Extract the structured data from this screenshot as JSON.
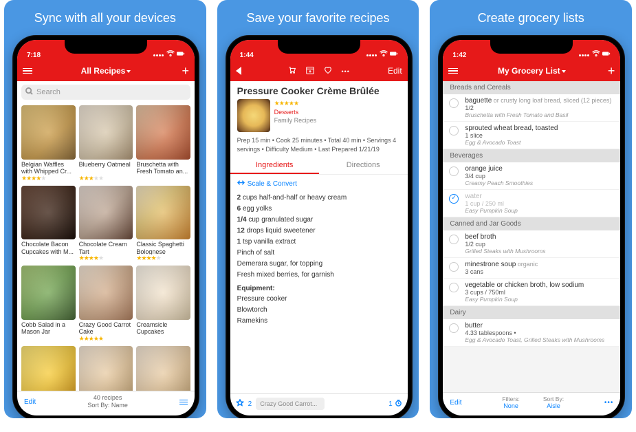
{
  "panels": {
    "p1_title": "Sync with all your devices",
    "p2_title": "Save your favorite recipes",
    "p3_title": "Create grocery lists"
  },
  "p1": {
    "time": "7:18",
    "nav_title": "All Recipes",
    "search_placeholder": "Search",
    "cards": [
      {
        "title": "Belgian Waffles with Whipped Cr...",
        "stars": 4
      },
      {
        "title": "Blueberry Oatmeal",
        "stars": 3
      },
      {
        "title": "Bruschetta with Fresh Tomato an...",
        "stars": 0
      },
      {
        "title": "Chocolate Bacon Cupcakes with M...",
        "stars": 0
      },
      {
        "title": "Chocolate Cream Tart",
        "stars": 4
      },
      {
        "title": "Classic Spaghetti Bolognese",
        "stars": 4
      },
      {
        "title": "Cobb Salad in a Mason Jar",
        "stars": 0
      },
      {
        "title": "Crazy Good Carrot Cake",
        "stars": 5
      },
      {
        "title": "Creamsicle Cupcakes",
        "stars": 0
      }
    ],
    "bottom_edit": "Edit",
    "bottom_count": "40 recipes",
    "bottom_sort": "Sort By: Name"
  },
  "p2": {
    "time": "1:44",
    "edit": "Edit",
    "title": "Pressure Cooker Crème Brûlée",
    "category": "Desserts",
    "source": "Family Recipes",
    "desc": "Prep 15 min • Cook 25 minutes • Total 40 min • Servings 4 servings • Difficulty Medium • Last Prepared 1/21/19",
    "tab_ing": "Ingredients",
    "tab_dir": "Directions",
    "scale": "Scale & Convert",
    "ingredients": [
      {
        "b": "2",
        "t": " cups half-and-half or heavy cream"
      },
      {
        "b": "6",
        "t": " egg yolks"
      },
      {
        "b": "1/4",
        "t": " cup granulated sugar"
      },
      {
        "b": "12",
        "t": " drops liquid sweetener"
      },
      {
        "b": "1",
        "t": " tsp vanilla extract"
      },
      {
        "b": "",
        "t": "Pinch of salt"
      },
      {
        "b": "",
        "t": "Demerara sugar, for topping"
      },
      {
        "b": "",
        "t": "Fresh mixed berries, for garnish"
      }
    ],
    "equipment_label": "Equipment:",
    "equipment": [
      "Pressure cooker",
      "Blowtorch",
      "Ramekins"
    ],
    "count": "2",
    "pill": "Crazy Good Carrot...",
    "timer": "1"
  },
  "p3": {
    "time": "1:42",
    "nav_title": "My Grocery List",
    "sections": [
      {
        "hdr": "Breads and Cereals",
        "items": [
          {
            "name": "baguette",
            "mod": " or crusty long loaf bread, sliced (12 pieces)",
            "qty": "1/2",
            "src": "Bruschetta with Fresh Tomato and Basil",
            "done": false
          },
          {
            "name": "sprouted wheat bread, toasted",
            "mod": "",
            "qty": "1 slice",
            "src": "Egg & Avocado Toast",
            "done": false
          }
        ]
      },
      {
        "hdr": "Beverages",
        "items": [
          {
            "name": "orange juice",
            "mod": "",
            "qty": "3/4 cup",
            "src": "Creamy Peach Smoothies",
            "done": false
          },
          {
            "name": "water",
            "mod": "",
            "qty": "1 cup / 250 ml",
            "src": "Easy Pumpkin Soup",
            "done": true
          }
        ]
      },
      {
        "hdr": "Canned and Jar Goods",
        "items": [
          {
            "name": "beef broth",
            "mod": "",
            "qty": "1/2 cup",
            "src": "Grilled Steaks with Mushrooms",
            "done": false
          },
          {
            "name": "minestrone soup",
            "mod": " organic",
            "qty": "3 cans",
            "src": "",
            "done": false
          },
          {
            "name": "vegetable or chicken broth, low sodium",
            "mod": "",
            "qty": "3 cups / 750ml",
            "src": "Easy Pumpkin Soup",
            "done": false
          }
        ]
      },
      {
        "hdr": "Dairy",
        "items": [
          {
            "name": "butter",
            "mod": "",
            "qty": "4.33 tablespoons •",
            "src": "Egg & Avocado Toast, Grilled Steaks with Mushrooms",
            "done": false
          }
        ]
      }
    ],
    "edit": "Edit",
    "filters_label": "Filters:",
    "filters_val": "None",
    "sort_label": "Sort By:",
    "sort_val": "Aisle"
  }
}
